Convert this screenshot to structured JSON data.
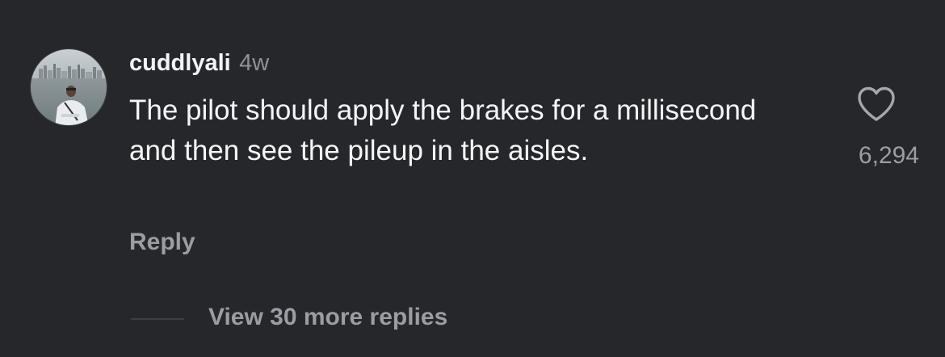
{
  "comment": {
    "username": "cuddlyali",
    "timestamp": "4w",
    "text": "The pilot should apply the brakes for a millisecond and then see the pileup in the aisles.",
    "reply_label": "Reply",
    "like_count": "6,294",
    "like_icon": "heart-outline-icon",
    "view_replies_label": "View 30 more replies"
  },
  "colors": {
    "background": "#25272b",
    "primary_text": "#f5f5f7",
    "secondary_text": "#9a9da3"
  }
}
